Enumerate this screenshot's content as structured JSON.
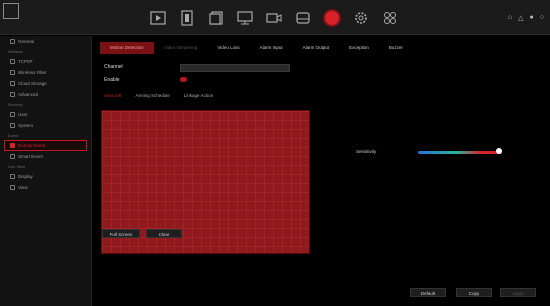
{
  "topbar": {
    "icons": [
      "playback-icon",
      "film-icon",
      "files-icon",
      "monitor-icon",
      "camera-icon",
      "storage-icon",
      "record-icon",
      "gear-icon",
      "grid-icon"
    ],
    "active_index": 6,
    "right_icons": [
      "user-icon",
      "alarm-icon",
      "lock-icon",
      "power-icon"
    ]
  },
  "sidebar": {
    "items": [
      {
        "type": "item",
        "label": "General"
      },
      {
        "type": "group",
        "label": "Network"
      },
      {
        "type": "item",
        "label": "TCP/IP"
      },
      {
        "type": "item",
        "label": "Wireless Filter"
      },
      {
        "type": "item",
        "label": "Cloud Storage"
      },
      {
        "type": "item",
        "label": "Advanced"
      },
      {
        "type": "group",
        "label": "Security"
      },
      {
        "type": "item",
        "label": "User"
      },
      {
        "type": "item",
        "label": "System"
      },
      {
        "type": "group",
        "label": "Event"
      },
      {
        "type": "item",
        "label": "Normal Event",
        "active": true
      },
      {
        "type": "item",
        "label": "Smart Event"
      },
      {
        "type": "group",
        "label": "Live View"
      },
      {
        "type": "item",
        "label": "Display"
      },
      {
        "type": "item",
        "label": "View"
      }
    ]
  },
  "main": {
    "tabs": [
      {
        "label": "Motion Detection",
        "state": "active"
      },
      {
        "label": "Video Tampering",
        "state": "dim"
      },
      {
        "label": "Video Loss",
        "state": "normal"
      },
      {
        "label": "Alarm Input",
        "state": "normal"
      },
      {
        "label": "Alarm Output",
        "state": "normal"
      },
      {
        "label": "Exception",
        "state": "normal"
      },
      {
        "label": "Buzzer",
        "state": "normal"
      }
    ],
    "channel_label": "Channel",
    "channel_value": "",
    "enable_label": "Enable",
    "subtabs": [
      {
        "label": "Area Set",
        "active": true
      },
      {
        "label": "Arming Schedule",
        "active": false
      },
      {
        "label": "Linkage Action",
        "active": false
      }
    ],
    "sensitivity_label": "Sensitivity",
    "sensitivity_value": 0.97,
    "fullscreen_label": "Full Screen",
    "clear_label": "Clear",
    "default_label": "Default",
    "copy_label": "Copy",
    "apply_label": "Apply"
  }
}
